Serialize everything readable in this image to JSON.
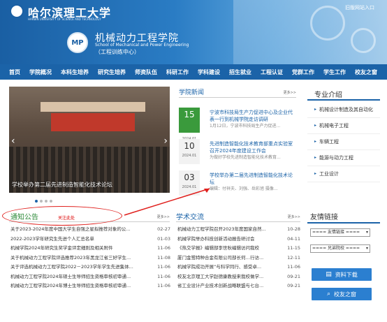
{
  "header": {
    "university": "哈尔滨理工大学",
    "university_en": "HARBIN UNIVERSITY OF SCIENCE AND TECHNOLOGY",
    "old_site": "旧版网站入口",
    "college_name": "机械动力工程学院",
    "college_en": "School of Mechanical and Power Engineering",
    "college_sub": "（工程训练中心）"
  },
  "nav": [
    "首页",
    "学院概况",
    "本科生培养",
    "研究生培养",
    "师资队伍",
    "科研工作",
    "学科建设",
    "招生就业",
    "工程认证",
    "党群工作",
    "学生工作",
    "校友之窗"
  ],
  "slider": {
    "caption": "学校举办第二届先进制造智能化技术论坛"
  },
  "news": {
    "title": "学院新闻",
    "more": "更多>>",
    "items": [
      {
        "day": "15",
        "ym": "2024.01",
        "title": "宁波市科技局生产力促进中心及企业代表一行到机械学院走访调研",
        "summary": "1月12日，宁波市科技局生产力促进..."
      },
      {
        "day": "10",
        "ym": "2024.01",
        "title": "先进制造智能化技术教育部重点实验室召开2024年度建设工作会",
        "summary": "为做好学校先进制造智能化技术教育..."
      },
      {
        "day": "03",
        "ym": "2024.01",
        "title": "学校举办第二届先进制造智能化技术论坛",
        "summary": "编辑：付祥夫、刘强、岳彩旭 摄像..."
      }
    ]
  },
  "majors": {
    "title": "专业介绍",
    "items": [
      "机械设计制造及其自动化",
      "机械电子工程",
      "车辆工程",
      "能源与动力工程",
      "工业设计"
    ]
  },
  "notices": {
    "title": "通知公告",
    "mark": "关注此处",
    "more": "更多>>",
    "items": [
      {
        "title": "关于2023-2024年度中国大学生自强之星拟推荐对象的公...",
        "date": "02-27"
      },
      {
        "title": "2022-2023学年研究生先进个人汇总名单",
        "date": "01-03"
      },
      {
        "title": "机械学院2024年研究生奖学金评定细则及相关附件",
        "date": "11-06"
      },
      {
        "title": "关于机械动力工程学院评选推荐2023年黑龙江省三好学生...",
        "date": "11-08"
      },
      {
        "title": "关于评选机械动力工程学院2022－2023学年学生先进集体...",
        "date": "11-06"
      },
      {
        "title": "机械动力工程学院2024年硕士生导师招生资格审核初审通...",
        "date": "11-06"
      },
      {
        "title": "机械动力工程学院2024年博士生导师招生资格审核初审通...",
        "date": "11-06"
      }
    ]
  },
  "academic": {
    "title": "学术交流",
    "more": "更多>>",
    "items": [
      {
        "title": "机械动力工程学院召开2023年度国家自然...",
        "date": "10-28"
      },
      {
        "title": "机械学院举办科技创新活动报告研讨会",
        "date": "04-11"
      },
      {
        "title": "《热交学报》编辑部李世秋编辑访问我校",
        "date": "11-15"
      },
      {
        "title": "厦门金鹭特种合金有限公司部长何…行访...",
        "date": "12-11"
      },
      {
        "title": "机械学院成功开展“与科学同行、感受卓...",
        "date": "11-06"
      },
      {
        "title": "校友北京理工大学赵德康教授来我校做学...",
        "date": "09-21"
      },
      {
        "title": "省工业设计产业技术创新战略联盟与七台...",
        "date": "09-21"
      }
    ]
  },
  "links": {
    "title": "友情链接",
    "select1": "==== 友情链接 ====",
    "select2": "==== 兄弟院校 ====",
    "download": "资料下载",
    "alumni": "校友之窗"
  }
}
